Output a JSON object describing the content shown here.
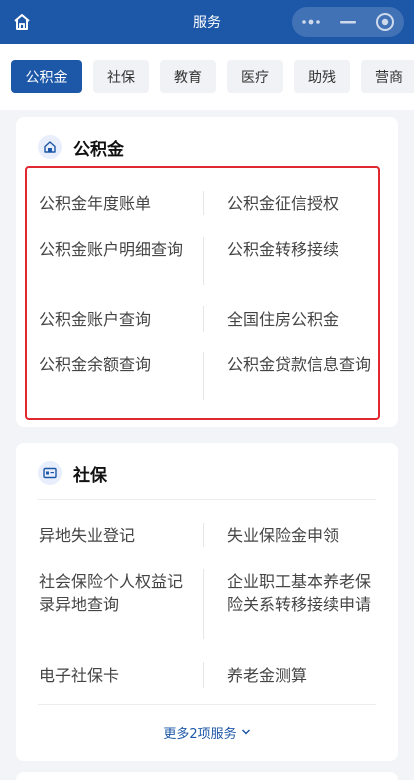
{
  "header": {
    "title": "服务",
    "icons": {
      "home": "home-icon",
      "more": "more-dots-icon",
      "minimize": "minimize-icon",
      "close": "target-close-icon"
    }
  },
  "tabs": [
    {
      "label": "公积金",
      "active": true
    },
    {
      "label": "社保",
      "active": false
    },
    {
      "label": "教育",
      "active": false
    },
    {
      "label": "医疗",
      "active": false
    },
    {
      "label": "助残",
      "active": false
    },
    {
      "label": "营商",
      "active": false
    }
  ],
  "sections": {
    "gjj": {
      "title": "公积金",
      "icon": "house-icon",
      "items": [
        "公积金年度账单",
        "公积金征信授权",
        "公积金账户明细查询",
        "公积金转移接续",
        "公积金账户查询",
        "全国住房公积金",
        "公积金余额查询",
        "公积金贷款信息查询"
      ]
    },
    "sb": {
      "title": "社保",
      "icon": "card-icon",
      "items": [
        "异地失业登记",
        "失业保险金申领",
        "社会保险个人权益记录异地查询",
        "企业职工基本养老保险关系转移接续申请",
        "电子社保卡",
        "养老金测算"
      ],
      "more_label": "更多2项服务"
    }
  },
  "colors": {
    "primary": "#1d57a8",
    "highlight_border": "#e1272f",
    "background": "#f3f4f7",
    "tab_bg": "#f1f2f5"
  }
}
